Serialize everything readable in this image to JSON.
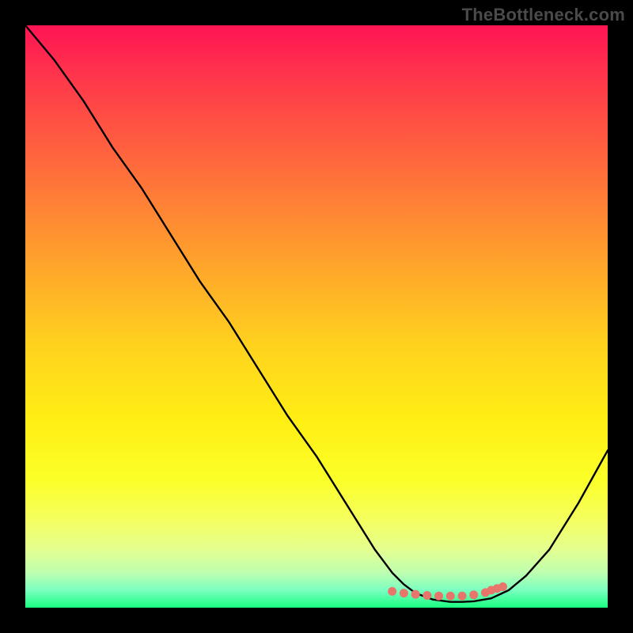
{
  "watermark": "TheBottleneck.com",
  "colors": {
    "background": "#000000",
    "curve_stroke": "#000000",
    "marker_fill": "#e8756b",
    "gradient_top": "#ff1454",
    "gradient_bottom": "#18ff80"
  },
  "chart_data": {
    "type": "line",
    "title": "",
    "xlabel": "",
    "ylabel": "",
    "xlim": [
      0,
      100
    ],
    "ylim": [
      0,
      100
    ],
    "x": [
      0,
      5,
      10,
      15,
      20,
      25,
      30,
      35,
      40,
      45,
      50,
      55,
      60,
      63,
      65,
      67,
      70,
      73,
      75,
      77,
      80,
      83,
      86,
      90,
      95,
      100
    ],
    "y": [
      100,
      94,
      87,
      79,
      72,
      64,
      56,
      49,
      41,
      33,
      26,
      18,
      10,
      6,
      4,
      2.5,
      1.4,
      1.0,
      1.0,
      1.1,
      1.6,
      3.0,
      5.5,
      10,
      18,
      27
    ],
    "optimal_zone": {
      "x": [
        63,
        65,
        67,
        69,
        71,
        73,
        75,
        77,
        79,
        80,
        81,
        82
      ],
      "y": [
        2.8,
        2.5,
        2.3,
        2.1,
        2.0,
        2.0,
        2.0,
        2.2,
        2.6,
        3.0,
        3.3,
        3.6
      ]
    }
  }
}
